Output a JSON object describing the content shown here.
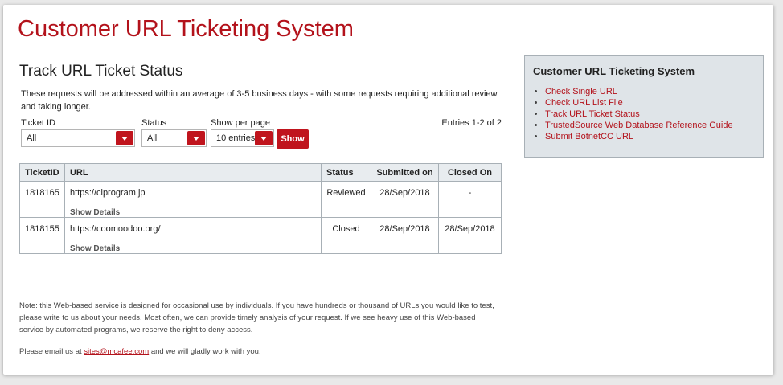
{
  "page": {
    "title": "Customer URL Ticketing System"
  },
  "main": {
    "section_title": "Track URL Ticket Status",
    "intro": "These requests will be addressed within an average of 3-5 business days - with some requests requiring additional review and taking longer.",
    "filters": {
      "ticket_id": {
        "label": "Ticket ID",
        "value": "All"
      },
      "status": {
        "label": "Status",
        "value": "All"
      },
      "per_page": {
        "label": "Show per page",
        "value": "10 entries"
      },
      "show_button": "Show",
      "entries_text": "Entries 1-2 of 2"
    },
    "table": {
      "headers": [
        "TicketID",
        "URL",
        "Status",
        "Submitted on",
        "Closed On"
      ],
      "rows": [
        {
          "ticket_id": "1818165",
          "url": "https://ciprogram.jp",
          "details": "Show Details",
          "status": "Reviewed",
          "submitted": "28/Sep/2018",
          "closed": "-"
        },
        {
          "ticket_id": "1818155",
          "url": "https://coomoodoo.org/",
          "details": "Show Details",
          "status": "Closed",
          "submitted": "28/Sep/2018",
          "closed": "28/Sep/2018"
        }
      ]
    },
    "note": "Note: this Web-based service is designed for occasional use by individuals. If you have hundreds or thousand of URLs you would like to test, please write to us about your needs. Most often, we can provide timely analysis of your request. If we see heavy use of this Web-based service by automated programs, we reserve the right to deny access.",
    "email": {
      "prefix": "Please email us at ",
      "address": "sites@mcafee.com",
      "suffix": " and we will gladly work with you."
    }
  },
  "sidebar": {
    "title": "Customer URL Ticketing System",
    "links": [
      "Check Single URL",
      "Check URL List File",
      "Track URL Ticket Status",
      "TrustedSource Web Database Reference Guide",
      "Submit BotnetCC URL"
    ]
  },
  "colors": {
    "brand_red": "#b3121b",
    "button_red": "#c0141d",
    "sidebar_bg": "#dfe4e8",
    "table_header_bg": "#e8ecef"
  }
}
